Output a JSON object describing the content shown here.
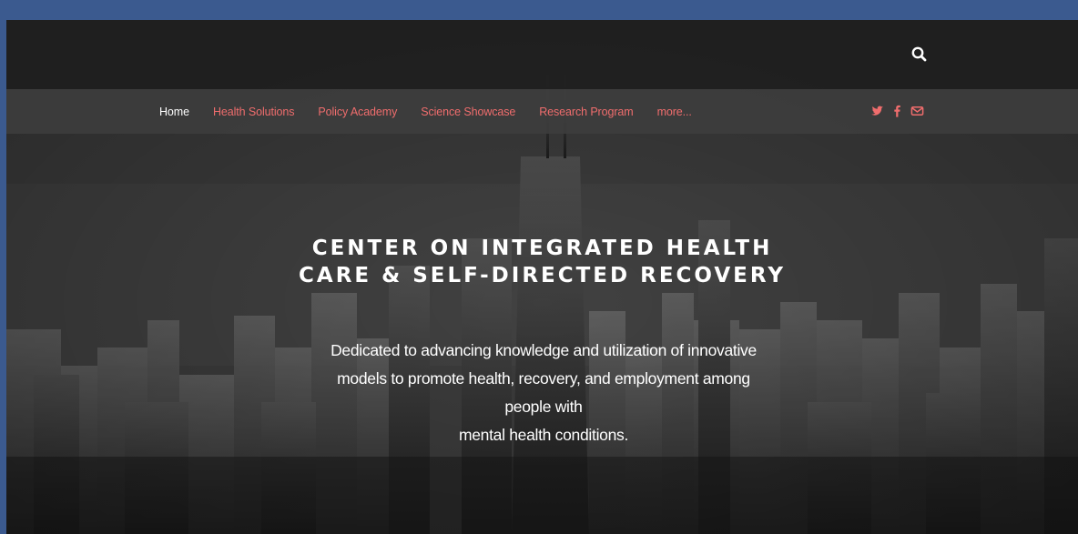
{
  "header": {
    "search_icon": "search-icon"
  },
  "nav": {
    "items": [
      {
        "label": "Home",
        "active": true
      },
      {
        "label": "Health Solutions",
        "active": false
      },
      {
        "label": "Policy Academy",
        "active": false
      },
      {
        "label": "Science Showcase",
        "active": false
      },
      {
        "label": "Research Program",
        "active": false
      },
      {
        "label": "more...",
        "active": false
      }
    ],
    "social_icons": [
      "twitter-icon",
      "facebook-icon",
      "mail-icon"
    ]
  },
  "hero": {
    "title_line1": "CENTER ON INTEGRATED HEALTH",
    "title_line2": "CARE & SELF-DIRECTED RECOVERY",
    "description_lines": [
      "Dedicated to advancing knowledge and utilization of innovative",
      "models to promote health, recovery, and employment among",
      "people with",
      "mental health conditions."
    ]
  },
  "colors": {
    "page_background": "#3b5a8f",
    "nav_link": "#f06d6d",
    "nav_active": "#ffffff",
    "hero_text": "#ffffff"
  }
}
